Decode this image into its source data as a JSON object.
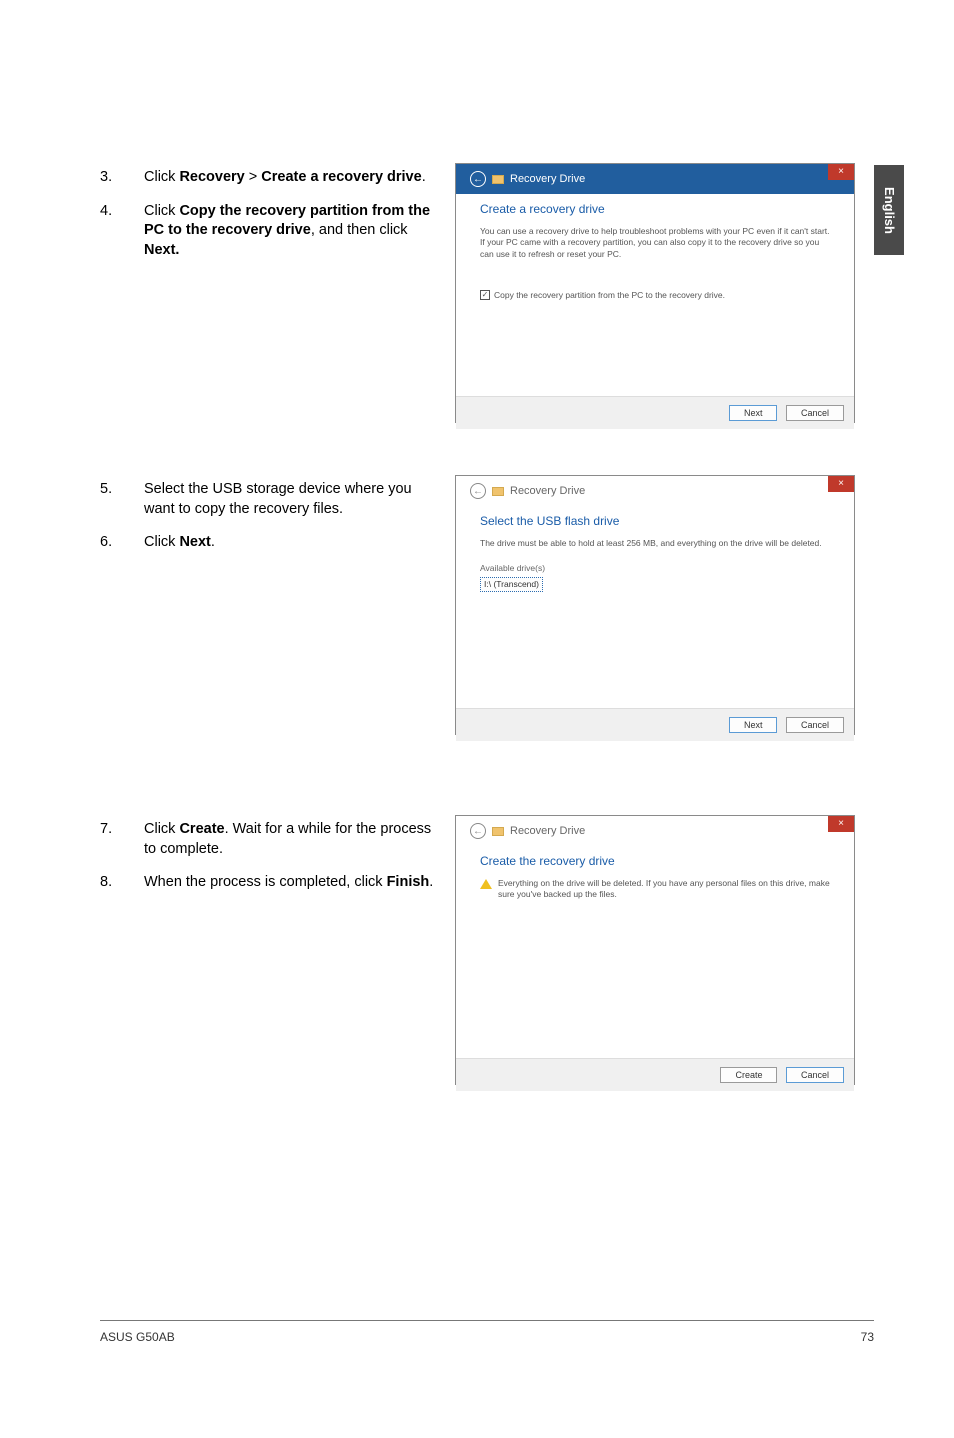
{
  "side_tab": "English",
  "steps": {
    "s3": {
      "num": "3.",
      "p1": "Click ",
      "b1": "Recovery",
      "sep": " > ",
      "b2": "Create a recovery drive",
      "tail": "."
    },
    "s4": {
      "num": "4.",
      "p1": "Click ",
      "b1": "Copy the recovery partition from the PC to the recovery drive",
      "mid": ", and then click ",
      "b2": "Next.",
      "tail": ""
    },
    "s5": {
      "num": "5.",
      "text": "Select the USB storage device where you want to copy the recovery files."
    },
    "s6": {
      "num": "6.",
      "p1": "Click ",
      "b1": "Next",
      "tail": "."
    },
    "s7": {
      "num": "7.",
      "p1": "Click ",
      "b1": "Create",
      "mid": ". Wait for a while for the process to complete."
    },
    "s8": {
      "num": "8.",
      "p1": "When the process is completed, click ",
      "b1": "Finish",
      "tail": "."
    }
  },
  "dlg1": {
    "title": "Recovery Drive",
    "heading": "Create a recovery drive",
    "para": "You can use a recovery drive to help troubleshoot problems with your PC even if it can't start. If your PC came with a recovery partition, you can also copy it to the recovery drive so you can use it to refresh or reset your PC.",
    "check_mark": "✓",
    "check_label": "Copy the recovery partition from the PC to the recovery drive.",
    "next": "Next",
    "cancel": "Cancel",
    "close": "×"
  },
  "dlg2": {
    "title": "Recovery Drive",
    "heading": "Select the USB flash drive",
    "para": "The drive must be able to hold at least 256 MB, and everything on the drive will be deleted.",
    "available": "Available drive(s)",
    "drive_item": "I:\\ (Transcend)",
    "next": "Next",
    "cancel": "Cancel",
    "close": "×"
  },
  "dlg3": {
    "title": "Recovery Drive",
    "heading": "Create the recovery drive",
    "warn": "Everything on the drive will be deleted. If you have any personal files on this drive, make sure you've backed up the files.",
    "create": "Create",
    "cancel": "Cancel",
    "close": "×"
  },
  "footer": {
    "left": "ASUS G50AB",
    "right": "73"
  }
}
